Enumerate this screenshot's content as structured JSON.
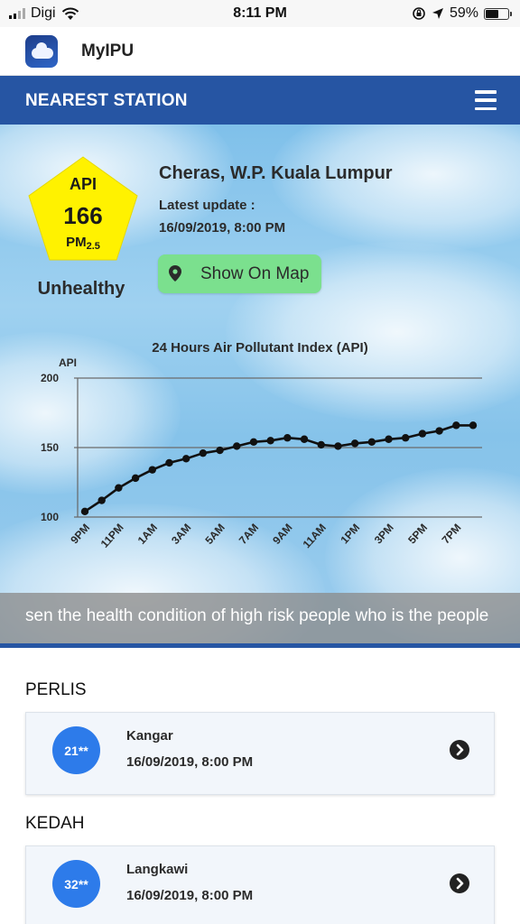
{
  "status_bar": {
    "carrier": "Digi",
    "time": "8:11 PM",
    "battery": "59%",
    "battery_level": 0.59
  },
  "app": {
    "name": "MyIPU"
  },
  "header": {
    "title": "NEAREST STATION",
    "menu_icon": "hamburger-menu-icon"
  },
  "nearest": {
    "api_label": "API",
    "api_value": "166",
    "pm_label": "PM",
    "pm_sub": "2.5",
    "status": "Unhealthy",
    "status_color": "#fff200",
    "station": "Cheras, W.P. Kuala Lumpur",
    "update_label": "Latest update :",
    "update_time": "16/09/2019, 8:00 PM",
    "map_button": "Show On Map",
    "map_button_color": "#7be08e"
  },
  "chart_data": {
    "type": "line",
    "title": "24 Hours Air Pollutant Index (API)",
    "ylabel": "API",
    "xlabel": "",
    "ylim": [
      100,
      200
    ],
    "yticks": [
      100,
      150,
      200
    ],
    "grid": true,
    "x": [
      "9PM",
      "10PM",
      "11PM",
      "12AM",
      "1AM",
      "2AM",
      "3AM",
      "4AM",
      "5AM",
      "6AM",
      "7AM",
      "8AM",
      "9AM",
      "10AM",
      "11AM",
      "12PM",
      "1PM",
      "2PM",
      "3PM",
      "4PM",
      "5PM",
      "6PM",
      "7PM",
      "8PM"
    ],
    "xtick_labels": [
      "9PM",
      "11PM",
      "1AM",
      "3AM",
      "5AM",
      "7AM",
      "9AM",
      "11AM",
      "1PM",
      "3PM",
      "5PM",
      "7PM"
    ],
    "series": [
      {
        "values": [
          104,
          112,
          121,
          128,
          134,
          139,
          142,
          146,
          148,
          151,
          154,
          155,
          157,
          156,
          152,
          151,
          153,
          154,
          156,
          157,
          160,
          162,
          166,
          166
        ]
      }
    ]
  },
  "ticker": {
    "text": "sen the health condition of high risk people who is the people"
  },
  "regions": [
    {
      "name": "PERLIS",
      "stations": [
        {
          "value": "21**",
          "name": "Kangar",
          "time": "16/09/2019, 8:00 PM"
        }
      ]
    },
    {
      "name": "KEDAH",
      "stations": [
        {
          "value": "32**",
          "name": "Langkawi",
          "time": "16/09/2019, 8:00 PM"
        }
      ]
    }
  ]
}
